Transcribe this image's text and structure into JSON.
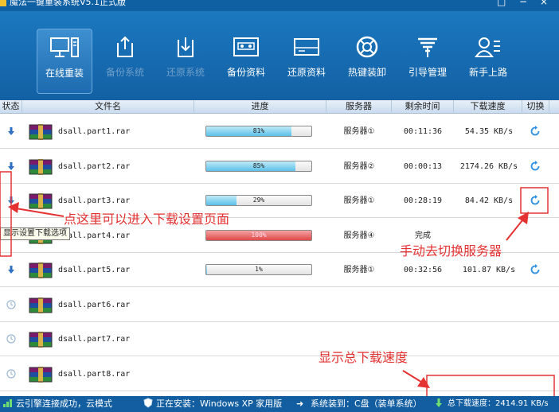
{
  "window": {
    "title": "魔法一键重装系统V5.1正式版"
  },
  "toolbar": {
    "items": [
      {
        "label": "在线重装",
        "icon": "monitor-icon"
      },
      {
        "label": "备份系统",
        "icon": "upload-icon"
      },
      {
        "label": "还原系统",
        "icon": "download-icon"
      },
      {
        "label": "备份资料",
        "icon": "tape-icon"
      },
      {
        "label": "还原资料",
        "icon": "drive-icon"
      },
      {
        "label": "热键装卸",
        "icon": "lifebuoy-icon"
      },
      {
        "label": "引导管理",
        "icon": "boot-icon"
      },
      {
        "label": "新手上路",
        "icon": "user-icon"
      }
    ]
  },
  "table": {
    "columns": [
      "状态",
      "文件名",
      "进度",
      "服务器",
      "剩余时间",
      "下载速度",
      "切换"
    ],
    "rows": [
      {
        "status": "downloading",
        "file": "dsall.part1.rar",
        "progress": 81,
        "progress_label": "81%",
        "server": "服务器①",
        "remaining": "00:11:36",
        "speed": "54.35 KB/s"
      },
      {
        "status": "downloading",
        "file": "dsall.part2.rar",
        "progress": 85,
        "progress_label": "85%",
        "server": "服务器②",
        "remaining": "00:00:13",
        "speed": "2174.26 KB/s"
      },
      {
        "status": "downloading",
        "file": "dsall.part3.rar",
        "progress": 29,
        "progress_label": "29%",
        "server": "服务器①",
        "remaining": "00:28:19",
        "speed": "84.42 KB/s"
      },
      {
        "status": "complete",
        "file": "dsall.part4.rar",
        "progress": 100,
        "progress_label": "100%",
        "server": "服务器④",
        "remaining": "完成",
        "speed": ""
      },
      {
        "status": "downloading",
        "file": "dsall.part5.rar",
        "progress": 1,
        "progress_label": "1%",
        "server": "服务器①",
        "remaining": "00:32:56",
        "speed": "101.87 KB/s"
      },
      {
        "status": "waiting",
        "file": "dsall.part6.rar",
        "progress": null,
        "progress_label": "",
        "server": "",
        "remaining": "",
        "speed": ""
      },
      {
        "status": "waiting",
        "file": "dsall.part7.rar",
        "progress": null,
        "progress_label": "",
        "server": "",
        "remaining": "",
        "speed": ""
      },
      {
        "status": "waiting",
        "file": "dsall.part8.rar",
        "progress": null,
        "progress_label": "",
        "server": "",
        "remaining": "",
        "speed": ""
      }
    ]
  },
  "tooltip": "显示设置下载选项",
  "annotations": {
    "settings": "点这里可以进入下载设置页面",
    "switch": "手动去切换服务器",
    "speed": "显示总下载速度"
  },
  "statusbar": {
    "cloud": "云引擎连接成功，云模式",
    "installing": "正在安装：Windows XP 家用版",
    "target": "系统装到：C盘（装单系统）",
    "total_speed": "总下载速度：2414.91 KB/s"
  },
  "colors": {
    "toolbar_bg": "#1669b0",
    "annotation": "#e43232",
    "progress_fill": "#5cc0e8",
    "progress_complete": "#e04848"
  }
}
